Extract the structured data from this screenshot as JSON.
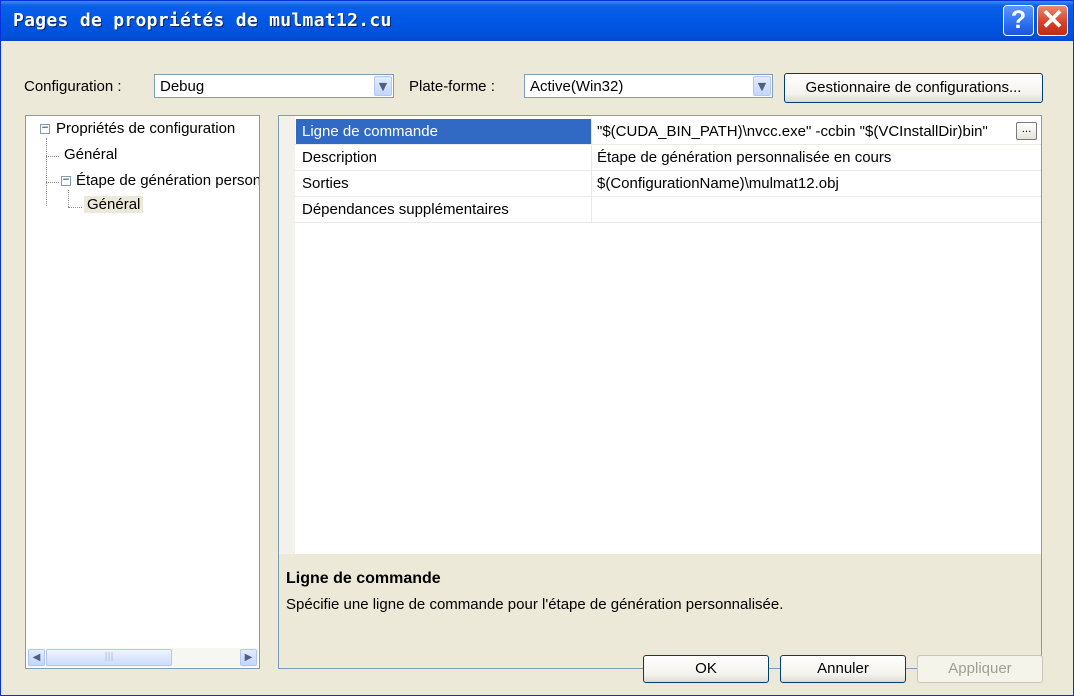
{
  "window": {
    "title": "Pages de propriétés de mulmat12.cu",
    "help_glyph": "?",
    "close_glyph": "✕"
  },
  "config_bar": {
    "configuration_label": "Configuration :",
    "configuration_value": "Debug",
    "platform_label": "Plate-forme :",
    "platform_value": "Active(Win32)",
    "manager_button": "Gestionnaire de configurations..."
  },
  "tree": {
    "items": [
      {
        "label": "Propriétés de configuration",
        "expander": "−"
      },
      {
        "label": "Général"
      },
      {
        "label": "Étape de génération personnalisée",
        "expander": "−"
      },
      {
        "label": "Général",
        "selected": true
      }
    ]
  },
  "properties": [
    {
      "name": "Ligne de commande",
      "value": "\"$(CUDA_BIN_PATH)\\nvcc.exe\" -ccbin \"$(VCInstallDir)bin\"",
      "selected": true
    },
    {
      "name": "Description",
      "value": "Étape de génération personnalisée en cours"
    },
    {
      "name": "Sorties",
      "value": "$(ConfigurationName)\\mulmat12.obj"
    },
    {
      "name": "Dépendances supplémentaires",
      "value": ""
    }
  ],
  "ellipsis_label": "...",
  "description": {
    "title": "Ligne de commande",
    "text": "Spécifie une ligne de commande pour l'étape de génération personnalisée."
  },
  "buttons": {
    "ok": "OK",
    "cancel": "Annuler",
    "apply": "Appliquer"
  },
  "icons": {
    "combo_arrow": "chevron-down-icon",
    "scroll_left": "arrow-left-icon",
    "scroll_right": "arrow-right-icon",
    "expander": "minus-box-icon"
  },
  "colors": {
    "title_bar": "#0058e6",
    "selection": "#316ac5",
    "dialog_face": "#ece9d8",
    "close_button": "#d6432a"
  }
}
